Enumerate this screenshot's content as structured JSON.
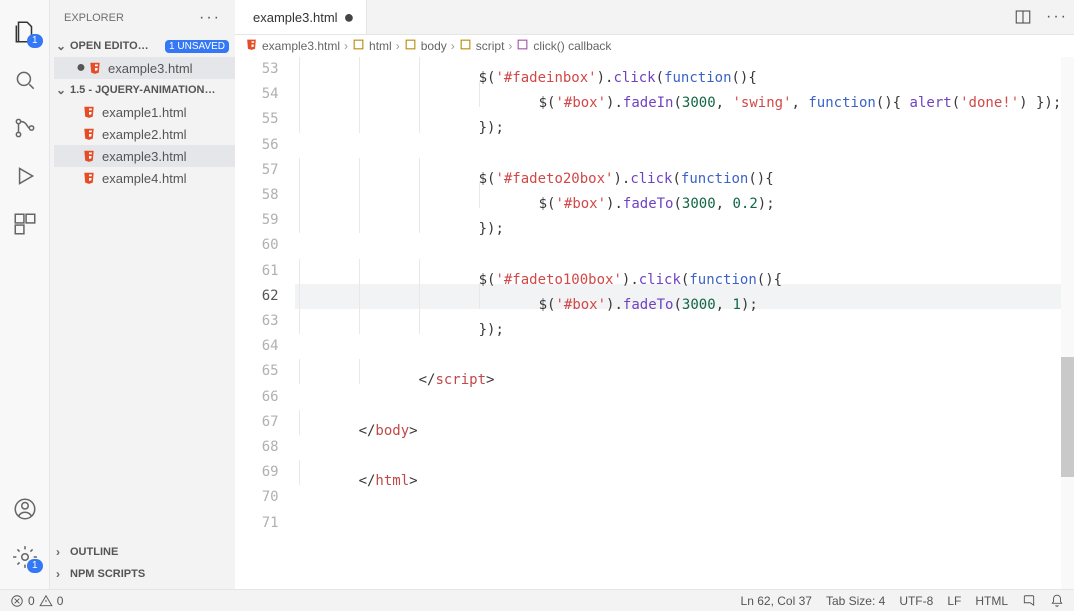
{
  "sidebar": {
    "title": "EXPLORER",
    "openEditors": {
      "label": "OPEN EDITO…",
      "badge": "1 UNSAVED",
      "items": [
        {
          "label": "example3.html",
          "dirty": true,
          "active": true
        }
      ]
    },
    "folder": {
      "label": "1.5 - JQUERY-ANIMATION…",
      "items": [
        {
          "label": "example1.html"
        },
        {
          "label": "example2.html"
        },
        {
          "label": "example3.html",
          "active": true
        },
        {
          "label": "example4.html"
        }
      ]
    },
    "bottom": [
      {
        "label": "OUTLINE"
      },
      {
        "label": "NPM SCRIPTS"
      }
    ]
  },
  "activitybar": {
    "explorer_badge": "1",
    "settings_badge": "1"
  },
  "editor": {
    "tab": {
      "label": "example3.html",
      "dirty": true
    },
    "breadcrumbs": [
      "example3.html",
      "html",
      "body",
      "script",
      "click() callback"
    ],
    "current_line_index": 9,
    "lines": [
      {
        "n": 53,
        "ind": 3,
        "tokens": [
          [
            "dim",
            "$("
          ],
          [
            "str",
            "'#fadeinbox'"
          ],
          [
            "dim",
            ")."
          ],
          [
            "fn",
            "click"
          ],
          [
            "dim",
            "("
          ],
          [
            "kw",
            "function"
          ],
          [
            "dim",
            "(){"
          ]
        ]
      },
      {
        "n": 54,
        "ind": 4,
        "tokens": [
          [
            "dim",
            "$("
          ],
          [
            "str",
            "'#box'"
          ],
          [
            "dim",
            ")."
          ],
          [
            "fn",
            "fadeIn"
          ],
          [
            "dim",
            "("
          ],
          [
            "num",
            "3000"
          ],
          [
            "dim",
            ", "
          ],
          [
            "str",
            "'swing'"
          ],
          [
            "dim",
            ", "
          ],
          [
            "kw",
            "function"
          ],
          [
            "dim",
            "(){ "
          ],
          [
            "fn",
            "alert"
          ],
          [
            "dim",
            "("
          ],
          [
            "str",
            "'done!'"
          ],
          [
            "dim",
            ") });"
          ]
        ]
      },
      {
        "n": 55,
        "ind": 3,
        "tokens": [
          [
            "dim",
            "});"
          ]
        ]
      },
      {
        "n": 56,
        "ind": 0,
        "tokens": []
      },
      {
        "n": 57,
        "ind": 3,
        "tokens": [
          [
            "dim",
            "$("
          ],
          [
            "str",
            "'#fadeto20box'"
          ],
          [
            "dim",
            ")."
          ],
          [
            "fn",
            "click"
          ],
          [
            "dim",
            "("
          ],
          [
            "kw",
            "function"
          ],
          [
            "dim",
            "(){"
          ]
        ]
      },
      {
        "n": 58,
        "ind": 4,
        "tokens": [
          [
            "dim",
            "$("
          ],
          [
            "str",
            "'#box'"
          ],
          [
            "dim",
            ")."
          ],
          [
            "fn",
            "fadeTo"
          ],
          [
            "dim",
            "("
          ],
          [
            "num",
            "3000"
          ],
          [
            "dim",
            ", "
          ],
          [
            "num",
            "0.2"
          ],
          [
            "dim",
            ");"
          ]
        ]
      },
      {
        "n": 59,
        "ind": 3,
        "tokens": [
          [
            "dim",
            "});"
          ]
        ]
      },
      {
        "n": 60,
        "ind": 0,
        "tokens": []
      },
      {
        "n": 61,
        "ind": 3,
        "tokens": [
          [
            "dim",
            "$("
          ],
          [
            "str",
            "'#fadeto100box'"
          ],
          [
            "dim",
            ")."
          ],
          [
            "fn",
            "click"
          ],
          [
            "dim",
            "("
          ],
          [
            "kw",
            "function"
          ],
          [
            "dim",
            "(){"
          ]
        ]
      },
      {
        "n": 62,
        "ind": 4,
        "tokens": [
          [
            "dim",
            "$("
          ],
          [
            "str",
            "'#box'"
          ],
          [
            "dim",
            ")."
          ],
          [
            "fn",
            "fadeTo"
          ],
          [
            "dim",
            "("
          ],
          [
            "num",
            "3000"
          ],
          [
            "dim",
            ", "
          ],
          [
            "num",
            "1"
          ],
          [
            "dim",
            ");"
          ]
        ]
      },
      {
        "n": 63,
        "ind": 3,
        "tokens": [
          [
            "dim",
            "});"
          ]
        ]
      },
      {
        "n": 64,
        "ind": 0,
        "tokens": []
      },
      {
        "n": 65,
        "ind": 2,
        "tokens": [
          [
            "dim",
            "</"
          ],
          [
            "tag",
            "script"
          ],
          [
            "dim",
            ">"
          ]
        ]
      },
      {
        "n": 66,
        "ind": 0,
        "tokens": []
      },
      {
        "n": 67,
        "ind": 1,
        "tokens": [
          [
            "dim",
            "</"
          ],
          [
            "tag",
            "body"
          ],
          [
            "dim",
            ">"
          ]
        ]
      },
      {
        "n": 68,
        "ind": 0,
        "tokens": []
      },
      {
        "n": 69,
        "ind": 1,
        "tokens": [
          [
            "dim",
            "</"
          ],
          [
            "tag",
            "html"
          ],
          [
            "dim",
            ">"
          ]
        ]
      },
      {
        "n": 70,
        "ind": 0,
        "tokens": []
      },
      {
        "n": 71,
        "ind": 0,
        "tokens": []
      }
    ]
  },
  "status": {
    "errors": "0",
    "warnings": "0",
    "cursor": "Ln 62, Col 37",
    "tabsize": "Tab Size: 4",
    "encoding": "UTF-8",
    "eol": "LF",
    "language": "HTML"
  }
}
